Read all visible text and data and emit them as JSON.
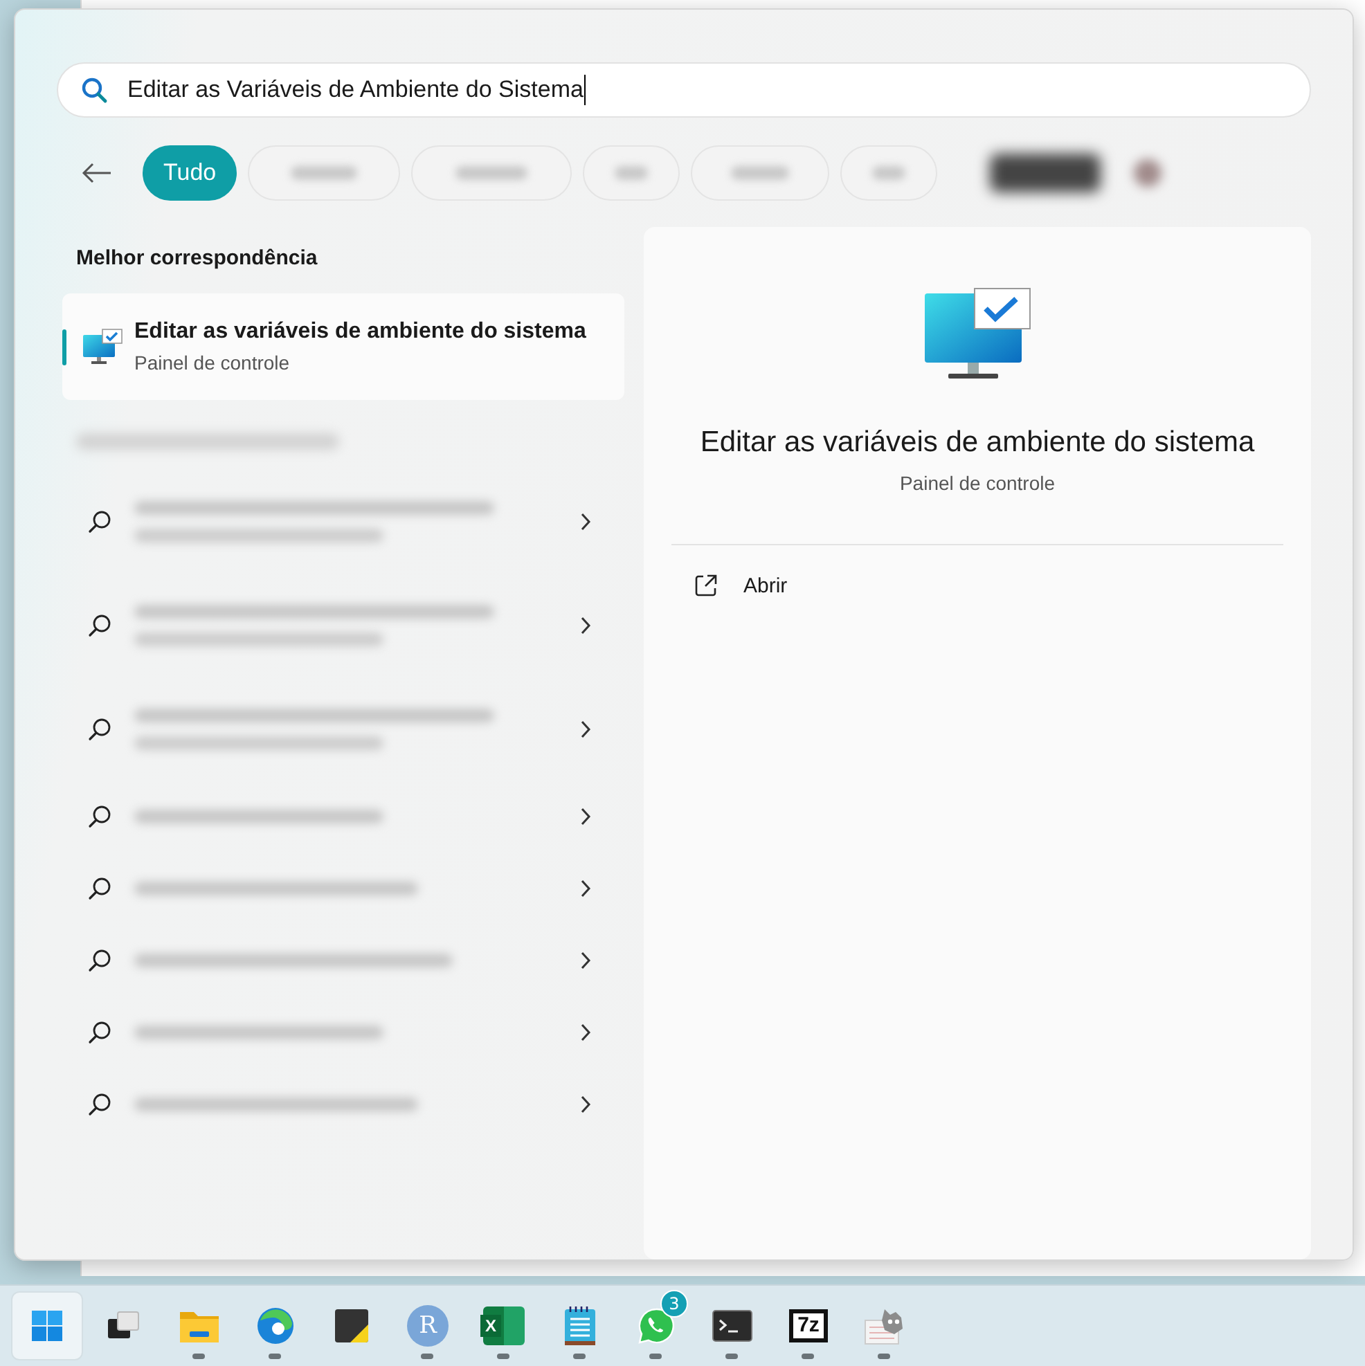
{
  "search": {
    "value": "Editar as Variáveis de Ambiente do Sistema"
  },
  "filters": [
    {
      "kind": "text",
      "label": "Tudo",
      "selected": true
    },
    {
      "kind": "blurred",
      "selected": false
    },
    {
      "kind": "blurred",
      "selected": false
    },
    {
      "kind": "blurred",
      "selected": false
    },
    {
      "kind": "blurred",
      "selected": false
    },
    {
      "kind": "blurred",
      "selected": false
    }
  ],
  "best_match": {
    "heading": "Melhor correspondência",
    "title": "Editar as variáveis de ambiente do sistema",
    "subtitle": "Painel de controle",
    "selected": true
  },
  "suggestions": [
    {
      "kind": "two-line"
    },
    {
      "kind": "two-line"
    },
    {
      "kind": "two-line"
    },
    {
      "kind": "one-line"
    },
    {
      "kind": "one-line"
    },
    {
      "kind": "one-line"
    },
    {
      "kind": "one-line"
    },
    {
      "kind": "one-line"
    }
  ],
  "details": {
    "title": "Editar as variáveis de ambiente do sistema",
    "subtitle": "Painel de controle",
    "actions": [
      {
        "label": "Abrir"
      }
    ]
  },
  "taskbar": [
    {
      "kind": "start",
      "running": false,
      "active": true
    },
    {
      "kind": "taskview",
      "running": false,
      "active": false
    },
    {
      "kind": "files",
      "running": true,
      "active": false
    },
    {
      "kind": "edge",
      "running": true,
      "active": false
    },
    {
      "kind": "sticky",
      "running": false,
      "active": false
    },
    {
      "kind": "r",
      "glyph": "R",
      "running": true,
      "active": false
    },
    {
      "kind": "excel",
      "glyph": "X",
      "running": true,
      "active": false
    },
    {
      "kind": "notepad",
      "running": true,
      "active": false
    },
    {
      "kind": "whatsapp",
      "badge": "3",
      "running": true,
      "active": false
    },
    {
      "kind": "terminal",
      "running": true,
      "active": false
    },
    {
      "kind": "sevenzip",
      "glyph": "7z",
      "running": true,
      "active": false
    },
    {
      "kind": "gimp",
      "running": true,
      "active": false
    }
  ]
}
